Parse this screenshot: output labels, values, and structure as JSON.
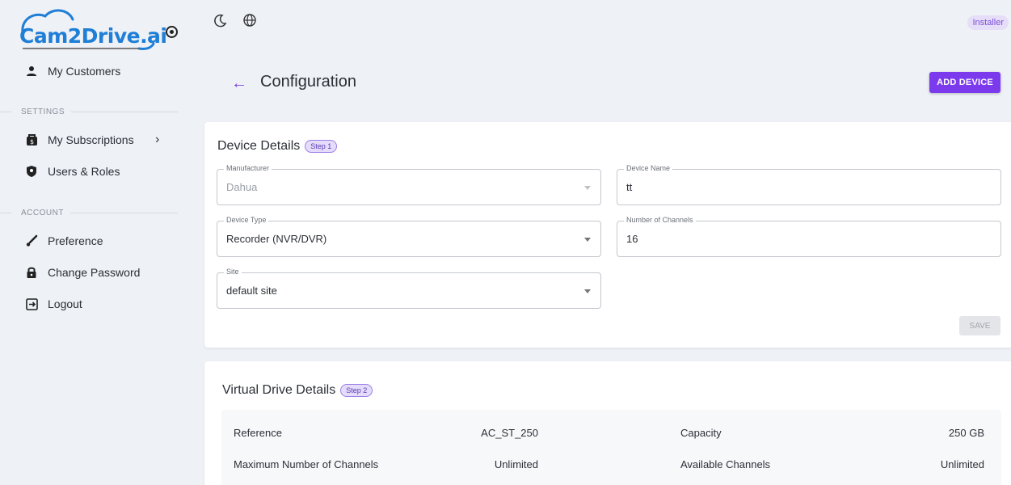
{
  "app": {
    "logo_text": "Cam2Drive.ai",
    "role_badge": "Installer"
  },
  "sidebar": {
    "items_top": [
      {
        "label": "My Customers",
        "icon": "person-icon"
      }
    ],
    "settings_label": "SETTINGS",
    "settings_items": [
      {
        "label": "My Subscriptions",
        "icon": "dollar-bag-icon"
      },
      {
        "label": "Users & Roles",
        "icon": "shield-icon"
      }
    ],
    "account_label": "ACCOUNT",
    "account_items": [
      {
        "label": "Preference",
        "icon": "brush-icon"
      },
      {
        "label": "Change Password",
        "icon": "lock-icon"
      },
      {
        "label": "Logout",
        "icon": "logout-icon"
      }
    ]
  },
  "header": {
    "title": "Configuration",
    "add_device_label": "ADD DEVICE"
  },
  "device_details": {
    "title": "Device Details",
    "step": "Step 1",
    "manufacturer": {
      "label": "Manufacturer",
      "value": "Dahua"
    },
    "device_name": {
      "label": "Device Name",
      "value": "tt"
    },
    "device_type": {
      "label": "Device Type",
      "value": "Recorder (NVR/DVR)"
    },
    "channels": {
      "label": "Number of Channels",
      "value": "16"
    },
    "site": {
      "label": "Site",
      "value": "default site"
    },
    "save_label": "SAVE"
  },
  "virtual_drive": {
    "title": "Virtual Drive Details",
    "step": "Step 2",
    "reference_label": "Reference",
    "reference_value": "AC_ST_250",
    "capacity_label": "Capacity",
    "capacity_value": "250 GB",
    "max_channels_label": "Maximum Number of Channels",
    "max_channels_value": "Unlimited",
    "available_channels_label": "Available Channels",
    "available_channels_value": "Unlimited"
  },
  "colors": {
    "accent": "#7c3aed",
    "logo": "#1f7ed6",
    "background": "#eef1f6"
  }
}
